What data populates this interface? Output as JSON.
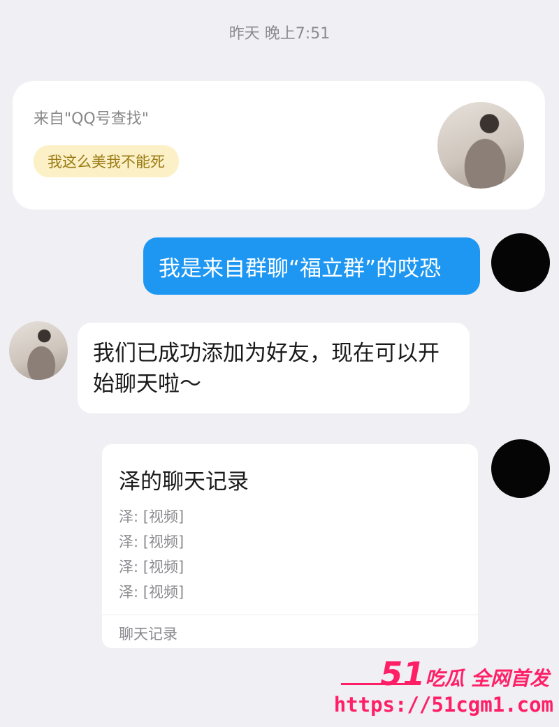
{
  "header": {
    "timestamp": "昨天 晚上7:51"
  },
  "source_card": {
    "label": "来自\"QQ号查找\"",
    "tag": "我这么美我不能死"
  },
  "messages": {
    "outgoing_1": "我是来自群聊“福立群”的哎恐",
    "incoming_1": "我们已成功添加为好友，现在可以开始聊天啦～"
  },
  "chat_record": {
    "title": "泽的聊天记录",
    "lines": [
      "泽: [视频]",
      "泽: [视频]",
      "泽: [视频]",
      "泽: [视频]"
    ],
    "footer": "聊天记录"
  },
  "watermark": {
    "brand_number": "51",
    "brand_text": "吃瓜 全网首发",
    "url": "https://51cgm1.com"
  },
  "colors": {
    "accent_blue": "#1e97f2",
    "watermark_pink": "#ff1f66"
  }
}
